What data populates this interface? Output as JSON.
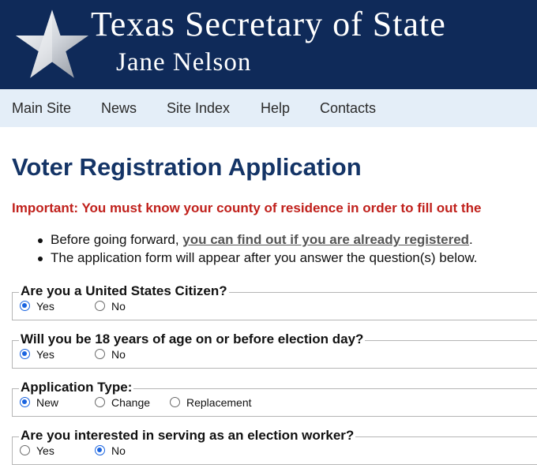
{
  "header": {
    "title": "Texas Secretary of State",
    "subtitle": "Jane Nelson"
  },
  "nav": {
    "items": [
      "Main Site",
      "News",
      "Site Index",
      "Help",
      "Contacts"
    ]
  },
  "main": {
    "heading": "Voter Registration Application",
    "important": "Important: You must know your county of residence in order to fill out the",
    "bullet1_prefix": "Before going forward, ",
    "bullet1_link": "you can find out if you are already registered",
    "bullet1_suffix": ".",
    "bullet2": "The application form will appear after you answer the question(s) below."
  },
  "questions": [
    {
      "legend": "Are you a United States Citizen?",
      "options": [
        "Yes",
        "No"
      ],
      "selected": "Yes"
    },
    {
      "legend": "Will you be 18 years of age on or before election day?",
      "options": [
        "Yes",
        "No"
      ],
      "selected": "Yes"
    },
    {
      "legend": "Application Type:",
      "options": [
        "New",
        "Change",
        "Replacement"
      ],
      "selected": "New"
    },
    {
      "legend": "Are you interested in serving as an election worker?",
      "options": [
        "Yes",
        "No"
      ],
      "selected": "No"
    }
  ],
  "colors": {
    "header_bg": "#0f2a59",
    "nav_bg": "#e4eef8",
    "heading": "#143466",
    "important": "#c0201b",
    "radio_selected": "#1a64e0"
  },
  "icons": {
    "logo": "star-icon"
  }
}
